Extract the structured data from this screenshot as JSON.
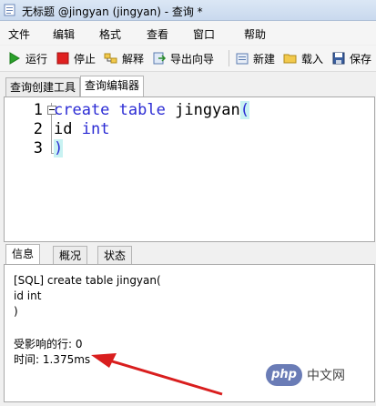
{
  "window": {
    "title": "无标题 @jingyan (jingyan) - 查询 *"
  },
  "menu": [
    {
      "label": "文件"
    },
    {
      "label": "编辑"
    },
    {
      "label": "格式"
    },
    {
      "label": "查看"
    },
    {
      "label": "窗口"
    },
    {
      "label": "帮助"
    }
  ],
  "toolbar": {
    "run": "运行",
    "stop": "停止",
    "explain": "解释",
    "export_wizard": "导出向导",
    "new": "新建",
    "load": "载入",
    "save": "保存"
  },
  "top_tabs": [
    {
      "label": "查询创建工具",
      "active": false
    },
    {
      "label": "查询编辑器",
      "active": true
    }
  ],
  "editor": {
    "line_numbers": [
      "1",
      "2",
      "3"
    ],
    "lines": [
      {
        "kw1": "create",
        "kw2": "table",
        "ident": "jingyan",
        "paren": "("
      },
      {
        "ident": "id",
        "kw": "int"
      },
      {
        "paren": ")"
      }
    ]
  },
  "bottom_tabs": [
    {
      "label": "信息",
      "active": true
    },
    {
      "label": "概况",
      "active": false
    },
    {
      "label": "状态",
      "active": false
    }
  ],
  "result": {
    "lines": [
      "[SQL] create table jingyan(",
      "id int",
      ")",
      "",
      "受影响的行: 0",
      "时间: 1.375ms"
    ]
  },
  "watermark": {
    "logo": "php",
    "text": "中文网"
  },
  "colors": {
    "keyword": "#2b2bd4",
    "arrow": "#d91e1e"
  }
}
